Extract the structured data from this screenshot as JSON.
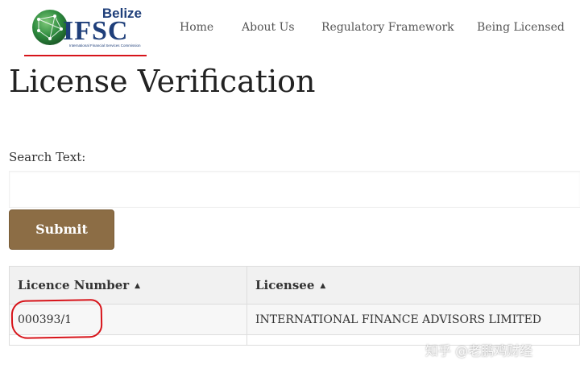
{
  "header": {
    "logo": {
      "country": "Belize",
      "name": "IFSC",
      "subtitle": "International Financial Services Commission"
    },
    "nav": {
      "home": "Home",
      "about": "About Us",
      "regulatory": "Regulatory Framework",
      "licensed": "Being Licensed"
    }
  },
  "page": {
    "title": "License Verification"
  },
  "search": {
    "label": "Search Text:",
    "value": "",
    "placeholder": ""
  },
  "form": {
    "submit_label": "Submit"
  },
  "table": {
    "columns": [
      {
        "label": "Licence Number",
        "sort": "▲"
      },
      {
        "label": "Licensee",
        "sort": "▲"
      }
    ],
    "rows": [
      {
        "licence_number": "000393/1",
        "licensee": "INTERNATIONAL FINANCE ADVISORS LIMITED"
      }
    ]
  },
  "watermark": "知乎 @老鹏鸡财经",
  "colors": {
    "accent": "#8c6d45",
    "brand": "#1f3f7a",
    "marker": "#d7141a"
  }
}
